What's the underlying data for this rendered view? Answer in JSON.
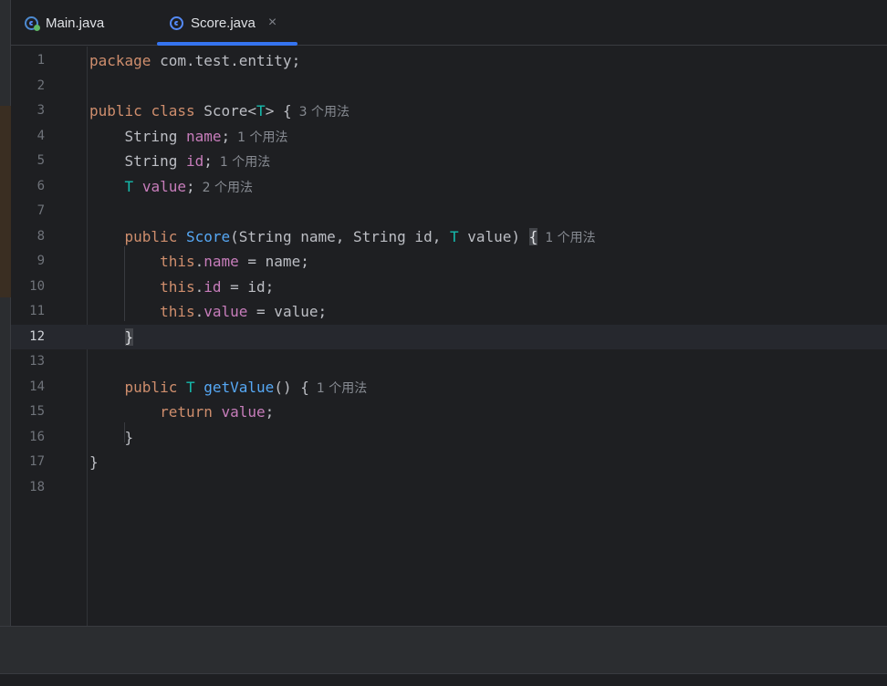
{
  "tabs": [
    {
      "label": "Main.java",
      "icon": "java-class-run-icon",
      "active": false
    },
    {
      "label": "Score.java",
      "icon": "java-class-icon",
      "active": true,
      "close": "×"
    }
  ],
  "colors": {
    "accent": "#3574f0",
    "keyword": "#cf8e6d",
    "field": "#c77dbb",
    "type_param": "#16baac",
    "method": "#56a8f5"
  },
  "editor": {
    "current_line": 12,
    "lines": [
      {
        "n": "1",
        "tokens": [
          {
            "t": "package",
            "c": "kw"
          },
          {
            "t": " com.test.entity;",
            "c": ""
          }
        ]
      },
      {
        "n": "2",
        "tokens": []
      },
      {
        "n": "3",
        "tokens": [
          {
            "t": "public",
            "c": "kw"
          },
          {
            "t": " ",
            "c": ""
          },
          {
            "t": "class",
            "c": "kw"
          },
          {
            "t": " Score<",
            "c": ""
          },
          {
            "t": "T",
            "c": "tp"
          },
          {
            "t": "> {",
            "c": ""
          }
        ],
        "hint": "3 个用法"
      },
      {
        "n": "4",
        "tokens": [
          {
            "t": "    String ",
            "c": ""
          },
          {
            "t": "name",
            "c": "fld"
          },
          {
            "t": ";",
            "c": ""
          }
        ],
        "hint": "1 个用法"
      },
      {
        "n": "5",
        "tokens": [
          {
            "t": "    String ",
            "c": ""
          },
          {
            "t": "id",
            "c": "fld"
          },
          {
            "t": ";",
            "c": ""
          }
        ],
        "hint": "1 个用法"
      },
      {
        "n": "6",
        "tokens": [
          {
            "t": "    ",
            "c": ""
          },
          {
            "t": "T",
            "c": "tp"
          },
          {
            "t": " ",
            "c": ""
          },
          {
            "t": "value",
            "c": "fld"
          },
          {
            "t": ";",
            "c": ""
          }
        ],
        "hint": "2 个用法"
      },
      {
        "n": "7",
        "tokens": []
      },
      {
        "n": "8",
        "tokens": [
          {
            "t": "    ",
            "c": ""
          },
          {
            "t": "public",
            "c": "kw"
          },
          {
            "t": " ",
            "c": ""
          },
          {
            "t": "Score",
            "c": "fn"
          },
          {
            "t": "(String name, String id, ",
            "c": ""
          },
          {
            "t": "T",
            "c": "tp"
          },
          {
            "t": " value) ",
            "c": ""
          },
          {
            "t": "{",
            "c": "brace-hl"
          }
        ],
        "hint": "1 个用法"
      },
      {
        "n": "9",
        "tokens": [
          {
            "t": "        ",
            "c": ""
          },
          {
            "t": "this",
            "c": "kw"
          },
          {
            "t": ".",
            "c": ""
          },
          {
            "t": "name",
            "c": "fld"
          },
          {
            "t": " = name;",
            "c": ""
          }
        ]
      },
      {
        "n": "10",
        "tokens": [
          {
            "t": "        ",
            "c": ""
          },
          {
            "t": "this",
            "c": "kw"
          },
          {
            "t": ".",
            "c": ""
          },
          {
            "t": "id",
            "c": "fld"
          },
          {
            "t": " = id;",
            "c": ""
          }
        ]
      },
      {
        "n": "11",
        "tokens": [
          {
            "t": "        ",
            "c": ""
          },
          {
            "t": "this",
            "c": "kw"
          },
          {
            "t": ".",
            "c": ""
          },
          {
            "t": "value",
            "c": "fld"
          },
          {
            "t": " = value;",
            "c": ""
          }
        ]
      },
      {
        "n": "12",
        "tokens": [
          {
            "t": "    ",
            "c": ""
          },
          {
            "t": "}",
            "c": "brace-hl"
          }
        ]
      },
      {
        "n": "13",
        "tokens": []
      },
      {
        "n": "14",
        "tokens": [
          {
            "t": "    ",
            "c": ""
          },
          {
            "t": "public",
            "c": "kw"
          },
          {
            "t": " ",
            "c": ""
          },
          {
            "t": "T",
            "c": "tp"
          },
          {
            "t": " ",
            "c": ""
          },
          {
            "t": "getValue",
            "c": "fn"
          },
          {
            "t": "() {",
            "c": ""
          }
        ],
        "hint": "1 个用法"
      },
      {
        "n": "15",
        "tokens": [
          {
            "t": "        ",
            "c": ""
          },
          {
            "t": "return",
            "c": "kw"
          },
          {
            "t": " ",
            "c": ""
          },
          {
            "t": "value",
            "c": "fld"
          },
          {
            "t": ";",
            "c": ""
          }
        ]
      },
      {
        "n": "16",
        "tokens": [
          {
            "t": "    }",
            "c": ""
          }
        ]
      },
      {
        "n": "17",
        "tokens": [
          {
            "t": "}",
            "c": ""
          }
        ]
      },
      {
        "n": "18",
        "tokens": []
      }
    ]
  }
}
